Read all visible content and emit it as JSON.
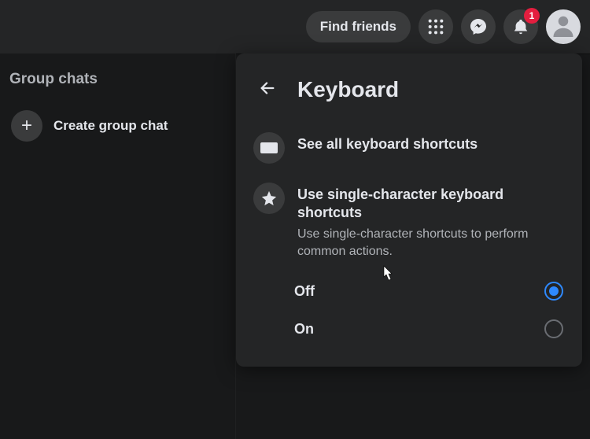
{
  "topbar": {
    "find_friends": "Find friends",
    "notification_count": "1"
  },
  "sidebar": {
    "title": "Group chats",
    "create_label": "Create group chat"
  },
  "panel": {
    "title": "Keyboard",
    "see_all": "See all keyboard shortcuts",
    "single_char": {
      "title": "Use single-character keyboard shortcuts",
      "desc": "Use single-character shortcuts to perform common actions."
    },
    "options": {
      "off": "Off",
      "on": "On",
      "selected": "off"
    }
  }
}
